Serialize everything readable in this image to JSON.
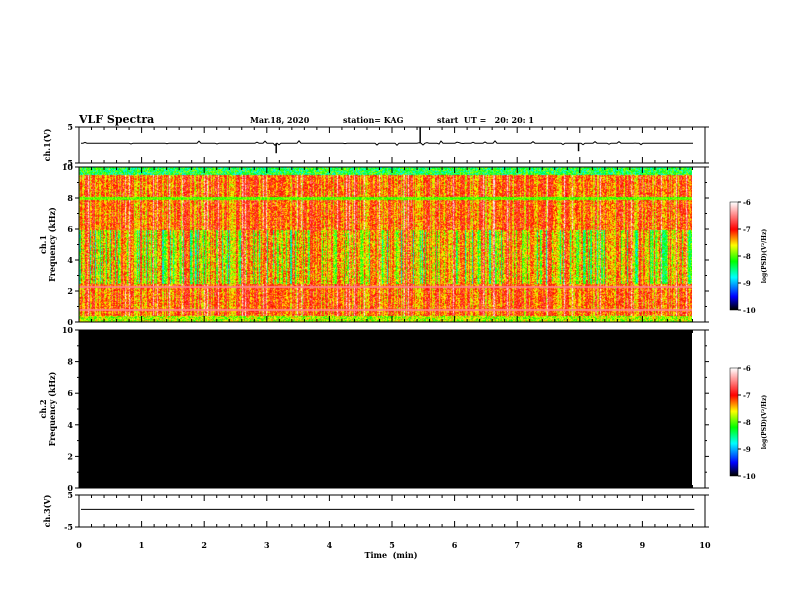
{
  "header": {
    "title": "VLF Spectra",
    "date": "Mar.18, 2020",
    "station": "station= KAG",
    "start": "start  UT =   20: 20: 1"
  },
  "chart_data": {
    "type": "heatmap",
    "xlabel": "Time  (min)",
    "xlim": [
      0,
      10
    ],
    "x_ticks": [
      "0",
      "1",
      "2",
      "3",
      "4",
      "5",
      "6",
      "7",
      "8",
      "9",
      "10"
    ],
    "data_end_min": 9.83,
    "panels": [
      {
        "id": "ch1-waveform",
        "ylabel": "ch.1(V)",
        "ylim": [
          -5,
          5
        ],
        "y_ticks": [
          "5",
          "-5"
        ],
        "type": "line",
        "baseline": 0.5
      },
      {
        "id": "ch1-spectrogram",
        "ylabel": "ch.1\nFrequency  (kHz)",
        "ylim": [
          0,
          10
        ],
        "y_ticks": [
          "0",
          "2",
          "4",
          "6",
          "8",
          "10"
        ],
        "type": "heatmap",
        "dominant_level": -7.2,
        "colorbar": {
          "label": "log(PSD)(V²/Hz)",
          "ticks": [
            "-6",
            "-7",
            "-8",
            "-9",
            "-10"
          ],
          "range": [
            -10,
            -6
          ]
        }
      },
      {
        "id": "ch2-spectrogram",
        "ylabel": "ch.2\nFrequency  (kHz)",
        "ylim": [
          0,
          10
        ],
        "y_ticks": [
          "0",
          "2",
          "4",
          "6",
          "8",
          "10"
        ],
        "type": "heatmap",
        "dominant_level": -10,
        "colorbar": {
          "label": "log(PSD)(V²/Hz)",
          "ticks": [
            "-6",
            "-7",
            "-8",
            "-9",
            "-10"
          ],
          "range": [
            -10,
            -6
          ]
        }
      },
      {
        "id": "ch3-waveform",
        "ylabel": "ch.3(V)",
        "ylim": [
          -5,
          5
        ],
        "y_ticks": [
          "5",
          "-5"
        ],
        "type": "line",
        "baseline": 0.5
      }
    ],
    "colormap": [
      "#000000",
      "#0000ff",
      "#00ffff",
      "#00ff00",
      "#ffff00",
      "#ff0000",
      "#ffffff"
    ]
  }
}
